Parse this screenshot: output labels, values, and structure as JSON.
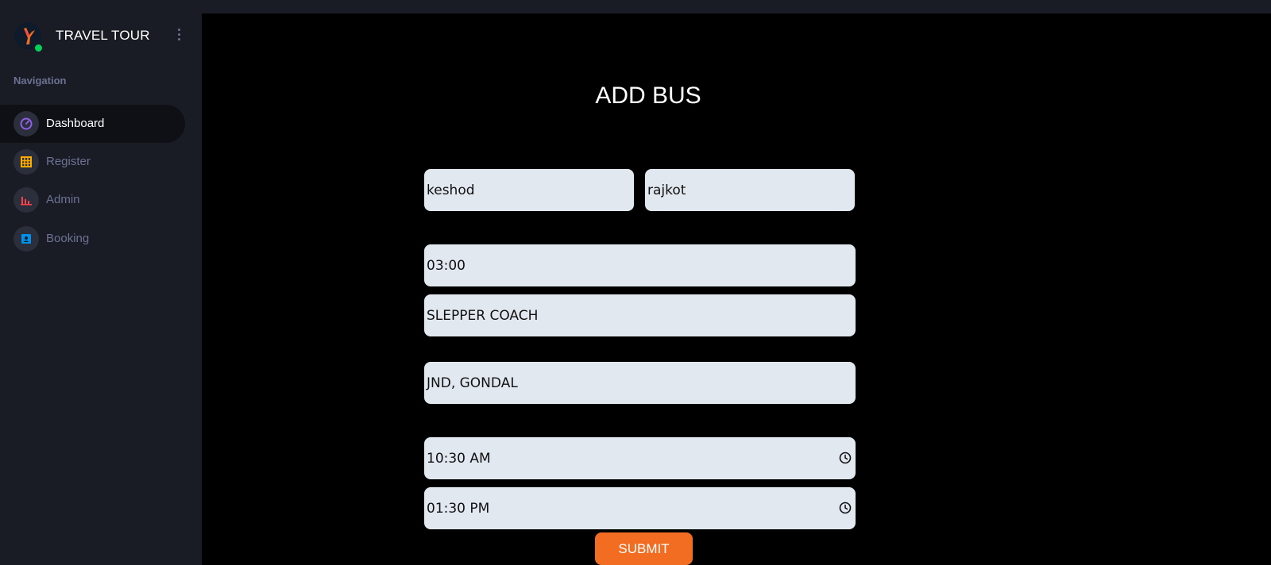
{
  "brand": {
    "title": "TRAVEL TOUR",
    "status_color": "#00d25b"
  },
  "sidebar": {
    "heading": "Navigation",
    "items": [
      {
        "label": "Dashboard",
        "icon": "speedometer-icon",
        "active": true,
        "icon_color": "#8f5fe8"
      },
      {
        "label": "Register",
        "icon": "table-icon",
        "active": false,
        "icon_color": "#ffab00"
      },
      {
        "label": "Admin",
        "icon": "bar-chart-icon",
        "active": false,
        "icon_color": "#fc424a"
      },
      {
        "label": "Booking",
        "icon": "contacts-icon",
        "active": false,
        "icon_color": "#0090e7"
      }
    ]
  },
  "form": {
    "title": "ADD BUS",
    "from": "keshod",
    "to": "rajkot",
    "duration": "03:00",
    "bus_type": "SLEPPER COACH",
    "stops": "JND, GONDAL",
    "departure_time": "10:30 AM",
    "arrival_time": "01:30 PM",
    "submit_label": "SUBMIT",
    "accent": "#f26d21"
  }
}
